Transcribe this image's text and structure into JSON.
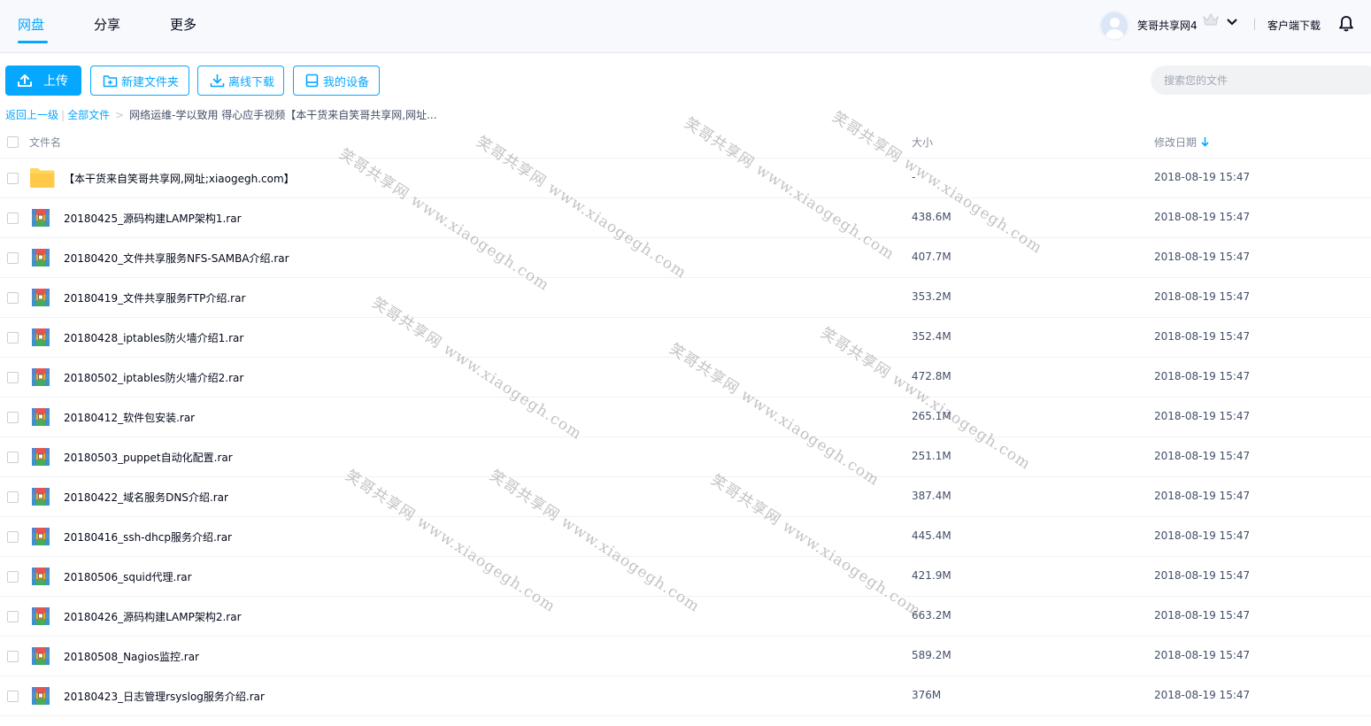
{
  "nav": {
    "tabs": [
      "网盘",
      "分享",
      "更多"
    ],
    "username": "笑哥共享网4",
    "client_download": "客户端下载"
  },
  "toolbar": {
    "upload": "上传",
    "new_folder": "新建文件夹",
    "offline_download": "离线下载",
    "my_devices": "我的设备",
    "search_placeholder": "搜索您的文件"
  },
  "breadcrumb": {
    "back": "返回上一级",
    "all_files": "全部文件",
    "separator": ">",
    "current": "网络运维-学以致用 得心应手视频【本干货来自笑哥共享网,网址..."
  },
  "table": {
    "headers": {
      "name": "文件名",
      "size": "大小",
      "modified": "修改日期"
    },
    "rows": [
      {
        "type": "folder",
        "name": "【本干货来自笑哥共享网,网址;xiaogegh.com】",
        "size": "-",
        "date": "2018-08-19 15:47"
      },
      {
        "type": "rar",
        "name": "20180425_源码构建LAMP架构1.rar",
        "size": "438.6M",
        "date": "2018-08-19 15:47"
      },
      {
        "type": "rar",
        "name": "20180420_文件共享服务NFS-SAMBA介绍.rar",
        "size": "407.7M",
        "date": "2018-08-19 15:47"
      },
      {
        "type": "rar",
        "name": "20180419_文件共享服务FTP介绍.rar",
        "size": "353.2M",
        "date": "2018-08-19 15:47"
      },
      {
        "type": "rar",
        "name": "20180428_iptables防火墙介绍1.rar",
        "size": "352.4M",
        "date": "2018-08-19 15:47"
      },
      {
        "type": "rar",
        "name": "20180502_iptables防火墙介绍2.rar",
        "size": "472.8M",
        "date": "2018-08-19 15:47"
      },
      {
        "type": "rar",
        "name": "20180412_软件包安装.rar",
        "size": "265.1M",
        "date": "2018-08-19 15:47"
      },
      {
        "type": "rar",
        "name": "20180503_puppet自动化配置.rar",
        "size": "251.1M",
        "date": "2018-08-19 15:47"
      },
      {
        "type": "rar",
        "name": "20180422_域名服务DNS介绍.rar",
        "size": "387.4M",
        "date": "2018-08-19 15:47"
      },
      {
        "type": "rar",
        "name": "20180416_ssh-dhcp服务介绍.rar",
        "size": "445.4M",
        "date": "2018-08-19 15:47"
      },
      {
        "type": "rar",
        "name": "20180506_squid代理.rar",
        "size": "421.9M",
        "date": "2018-08-19 15:47"
      },
      {
        "type": "rar",
        "name": "20180426_源码构建LAMP架构2.rar",
        "size": "663.2M",
        "date": "2018-08-19 15:47"
      },
      {
        "type": "rar",
        "name": "20180508_Nagios监控.rar",
        "size": "589.2M",
        "date": "2018-08-19 15:47"
      },
      {
        "type": "rar",
        "name": "20180423_日志管理rsyslog服务介绍.rar",
        "size": "376M",
        "date": "2018-08-19 15:47"
      }
    ]
  },
  "watermark_text": "笑哥共享网 www.xiaogegh.com",
  "colors": {
    "accent": "#06a7ff",
    "text": "#03081a",
    "muted": "#818999"
  }
}
